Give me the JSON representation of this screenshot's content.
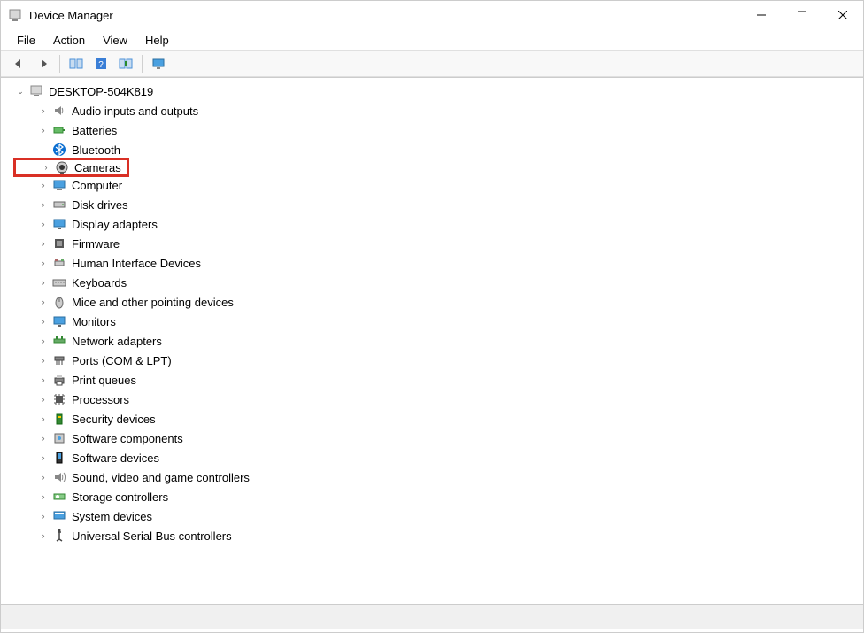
{
  "window": {
    "title": "Device Manager"
  },
  "menu": {
    "file": "File",
    "action": "Action",
    "view": "View",
    "help": "Help"
  },
  "tree": {
    "root": {
      "label": "DESKTOP-504K819",
      "expanded": true
    },
    "items": [
      {
        "icon": "speaker-icon",
        "label": "Audio inputs and outputs",
        "highlight": false,
        "expandable": true
      },
      {
        "icon": "battery-icon",
        "label": "Batteries",
        "highlight": false,
        "expandable": true
      },
      {
        "icon": "bluetooth-icon",
        "label": "Bluetooth",
        "highlight": false,
        "expandable": false
      },
      {
        "icon": "camera-icon",
        "label": "Cameras",
        "highlight": true,
        "expandable": true
      },
      {
        "icon": "computer-icon",
        "label": "Computer",
        "highlight": false,
        "expandable": true
      },
      {
        "icon": "disk-icon",
        "label": "Disk drives",
        "highlight": false,
        "expandable": true
      },
      {
        "icon": "display-icon",
        "label": "Display adapters",
        "highlight": false,
        "expandable": true
      },
      {
        "icon": "firmware-icon",
        "label": "Firmware",
        "highlight": false,
        "expandable": true
      },
      {
        "icon": "hid-icon",
        "label": "Human Interface Devices",
        "highlight": false,
        "expandable": true
      },
      {
        "icon": "keyboard-icon",
        "label": "Keyboards",
        "highlight": false,
        "expandable": true
      },
      {
        "icon": "mouse-icon",
        "label": "Mice and other pointing devices",
        "highlight": false,
        "expandable": true
      },
      {
        "icon": "monitor-icon",
        "label": "Monitors",
        "highlight": false,
        "expandable": true
      },
      {
        "icon": "network-icon",
        "label": "Network adapters",
        "highlight": false,
        "expandable": true
      },
      {
        "icon": "ports-icon",
        "label": "Ports (COM & LPT)",
        "highlight": false,
        "expandable": true
      },
      {
        "icon": "printer-icon",
        "label": "Print queues",
        "highlight": false,
        "expandable": true
      },
      {
        "icon": "cpu-icon",
        "label": "Processors",
        "highlight": false,
        "expandable": true
      },
      {
        "icon": "security-icon",
        "label": "Security devices",
        "highlight": false,
        "expandable": true
      },
      {
        "icon": "component-icon",
        "label": "Software components",
        "highlight": false,
        "expandable": true
      },
      {
        "icon": "softdev-icon",
        "label": "Software devices",
        "highlight": false,
        "expandable": true
      },
      {
        "icon": "sound-icon",
        "label": "Sound, video and game controllers",
        "highlight": false,
        "expandable": true
      },
      {
        "icon": "storage-icon",
        "label": "Storage controllers",
        "highlight": false,
        "expandable": true
      },
      {
        "icon": "system-icon",
        "label": "System devices",
        "highlight": false,
        "expandable": true
      },
      {
        "icon": "usb-icon",
        "label": "Universal Serial Bus controllers",
        "highlight": false,
        "expandable": true
      }
    ]
  }
}
